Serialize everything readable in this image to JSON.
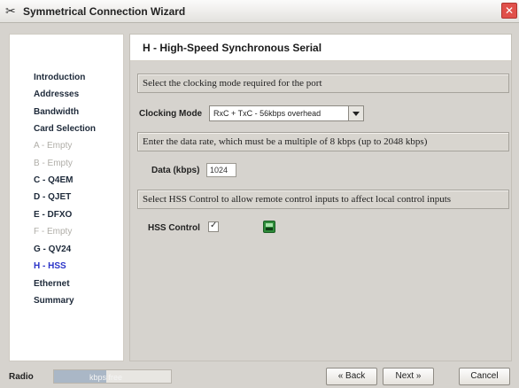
{
  "window": {
    "title": "Symmetrical Connection Wizard",
    "app_icon": "tools-icon",
    "close_glyph": "✕"
  },
  "sidebar": {
    "items": [
      {
        "label": "Introduction",
        "state": "normal"
      },
      {
        "label": "Addresses",
        "state": "normal"
      },
      {
        "label": "Bandwidth",
        "state": "normal"
      },
      {
        "label": "Card Selection",
        "state": "normal"
      },
      {
        "label": "A - Empty",
        "state": "empty"
      },
      {
        "label": "B - Empty",
        "state": "empty"
      },
      {
        "label": "C - Q4EM",
        "state": "normal"
      },
      {
        "label": "D - QJET",
        "state": "normal"
      },
      {
        "label": "E - DFXO",
        "state": "normal"
      },
      {
        "label": "F - Empty",
        "state": "empty"
      },
      {
        "label": "G - QV24",
        "state": "normal"
      },
      {
        "label": "H - HSS",
        "state": "active"
      },
      {
        "label": "Ethernet",
        "state": "normal"
      },
      {
        "label": "Summary",
        "state": "normal"
      }
    ]
  },
  "main": {
    "heading": "H - High-Speed Synchronous Serial",
    "clocking_prompt": "Select the clocking mode required for the port",
    "clocking_label": "Clocking Mode",
    "clocking_value": "RxC + TxC - 56kbps overhead",
    "rate_prompt": "Enter the data rate, which must be a multiple of 8 kbps (up to 2048 kbps)",
    "data_label": "Data (kbps)",
    "data_value": "1024",
    "hss_prompt": "Select HSS Control to allow remote control inputs to affect local control inputs",
    "hss_label": "HSS Control",
    "hss_checked": true,
    "hss_status_icon": "green-status-icon"
  },
  "footer": {
    "radio_label": "Radio",
    "progress_text": "kbps free",
    "progress_fraction": 0.45,
    "back_label": "« Back",
    "next_label": "Next »",
    "cancel_label": "Cancel"
  },
  "colors": {
    "active_item": "#2a33c8",
    "empty_item": "#b0aea8",
    "close_button": "#e0504a"
  }
}
